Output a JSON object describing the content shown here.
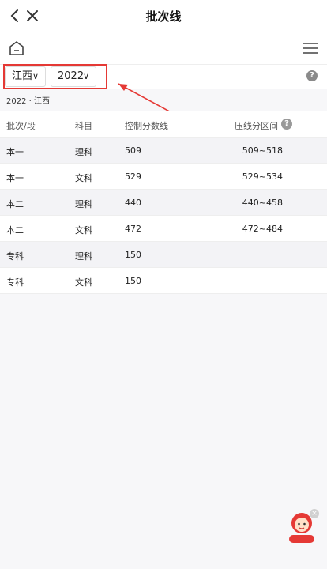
{
  "header": {
    "title": "批次线"
  },
  "filters": {
    "province": "江西",
    "year": "2022"
  },
  "subtitle": "2022 · 江西",
  "table": {
    "headers": [
      "批次/段",
      "科目",
      "控制分数线",
      "压线分区间"
    ],
    "rows": [
      {
        "batch": "本一",
        "subject": "理科",
        "score": "509",
        "range": "509~518"
      },
      {
        "batch": "本一",
        "subject": "文科",
        "score": "529",
        "range": "529~534"
      },
      {
        "batch": "本二",
        "subject": "理科",
        "score": "440",
        "range": "440~458"
      },
      {
        "batch": "本二",
        "subject": "文科",
        "score": "472",
        "range": "472~484"
      },
      {
        "batch": "专科",
        "subject": "理科",
        "score": "150",
        "range": ""
      },
      {
        "batch": "专科",
        "subject": "文科",
        "score": "150",
        "range": ""
      }
    ]
  },
  "icons": {
    "back": "back-icon",
    "close": "close-icon",
    "home": "home-icon",
    "menu": "hamburger-menu-icon",
    "help": "question-icon",
    "mascot": "assistant-mascot-icon"
  },
  "colors": {
    "annotation": "#e53935",
    "accent": "#e53935"
  }
}
